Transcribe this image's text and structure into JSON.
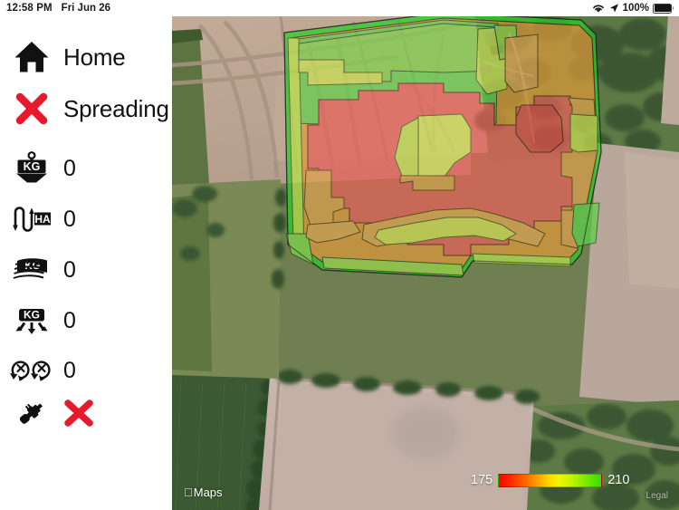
{
  "status_bar": {
    "time": "12:58 PM",
    "date": "Fri Jun 26",
    "battery_percent": "100%",
    "wifi_icon": "wifi-icon",
    "location_icon": "location-arrow-icon",
    "battery_icon": "battery-full-icon"
  },
  "sidebar": {
    "items": [
      {
        "icon": "home-icon",
        "label": "Home",
        "value": ""
      },
      {
        "icon": "red-x-icon",
        "label": "Spreading",
        "value": ""
      },
      {
        "icon": "kg-scale-icon",
        "label": "",
        "value": "0"
      },
      {
        "icon": "ha-serpentine-icon",
        "label": "",
        "value": "0"
      },
      {
        "icon": "kg-field-stack-icon",
        "label": "",
        "value": "0"
      },
      {
        "icon": "kg-spread-rate-icon",
        "label": "",
        "value": "0"
      },
      {
        "icon": "spreader-discs-icon",
        "label": "",
        "value": "0"
      },
      {
        "icon": "plug-connector-icon",
        "label": "",
        "value": "x"
      }
    ]
  },
  "map": {
    "provider_credit": "Maps",
    "apple_logo": "apple-logo-icon",
    "legal_label": "Legal",
    "legend": {
      "min": "175",
      "max": "210",
      "gradient_low_color": "#ff0000",
      "gradient_mid_color": "#ffff00",
      "gradient_high_color": "#35e000"
    }
  },
  "colors": {
    "accent_red": "#e8192c",
    "text": "#111111",
    "sidebar_bg": "#ffffff"
  }
}
